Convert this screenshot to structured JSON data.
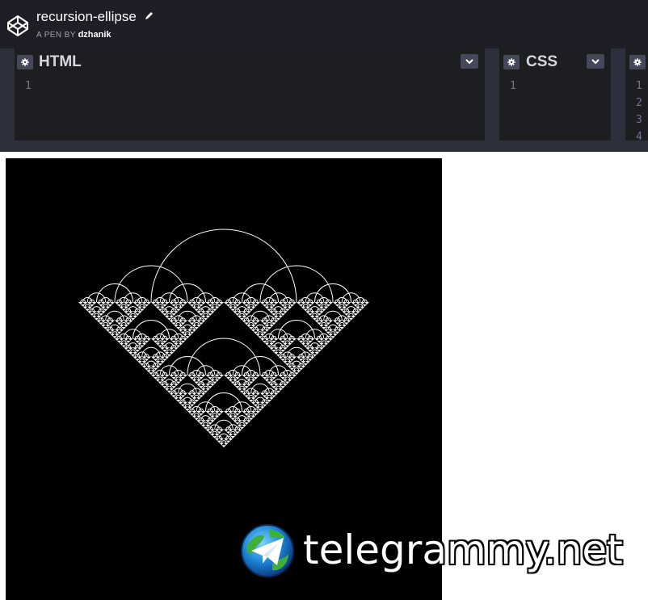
{
  "pen": {
    "title": "recursion-ellipse",
    "byline_prefix": "A PEN BY",
    "author": "dzhanik"
  },
  "editors": [
    {
      "title": "HTML",
      "line_numbers": [
        "1"
      ]
    },
    {
      "title": "CSS",
      "line_numbers": [
        "1"
      ]
    },
    {
      "title": "",
      "line_numbers": [
        "1",
        "2",
        "3",
        "4"
      ]
    }
  ],
  "icons": {
    "logo": "codepen-cube-icon",
    "edit": "pencil-icon",
    "settings": "gear-icon",
    "collapse": "chevron-down-icon",
    "watermark": "telegram-globe-icon"
  },
  "colors": {
    "topbar": "#1e1f26",
    "editor_bg": "#1d1e22",
    "preview_bg": "#000000",
    "fractal": "#ffffff"
  },
  "watermark": {
    "text": "telegrammy.net"
  }
}
